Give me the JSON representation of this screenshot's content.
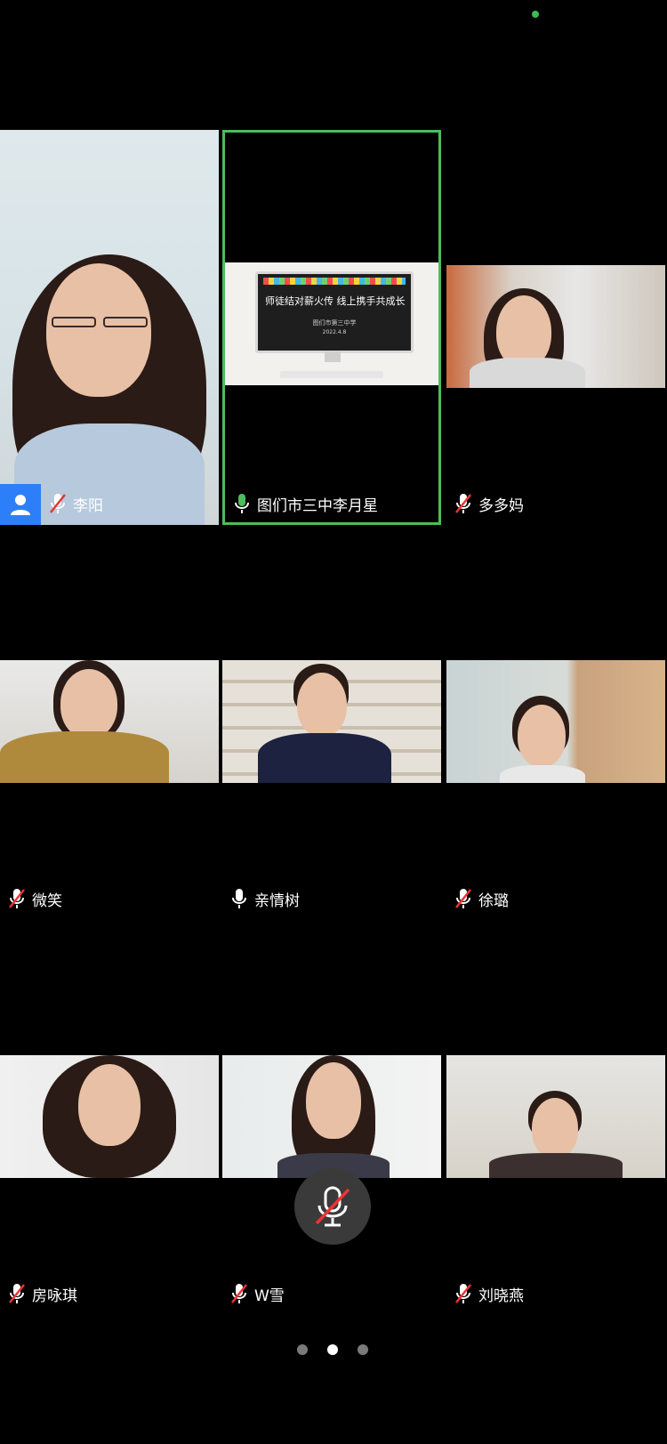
{
  "status_dot_color": "#3cba54",
  "speaking_border_color": "#4cbd5b",
  "self_avatar_color": "#2d7ff9",
  "participants": [
    {
      "name": "李阳",
      "mic": "muted",
      "self": true
    },
    {
      "name": "图们市三中李月星",
      "mic": "on",
      "speaking": true,
      "sharing": true
    },
    {
      "name": "多多妈",
      "mic": "muted"
    },
    {
      "name": "微笑",
      "mic": "muted"
    },
    {
      "name": "亲情树",
      "mic": "on"
    },
    {
      "name": "徐璐",
      "mic": "muted"
    },
    {
      "name": "房咏琪",
      "mic": "muted"
    },
    {
      "name": "W雪",
      "mic": "muted"
    },
    {
      "name": "刘晓燕",
      "mic": "muted"
    }
  ],
  "shared_slide": {
    "title": "师徒结对薪火传 线上携手共成长",
    "subtitle": "图们市第三中学",
    "date": "2022.4.8"
  },
  "controls": {
    "main_mic": "muted"
  },
  "pager": {
    "pages": 3,
    "current": 2
  }
}
